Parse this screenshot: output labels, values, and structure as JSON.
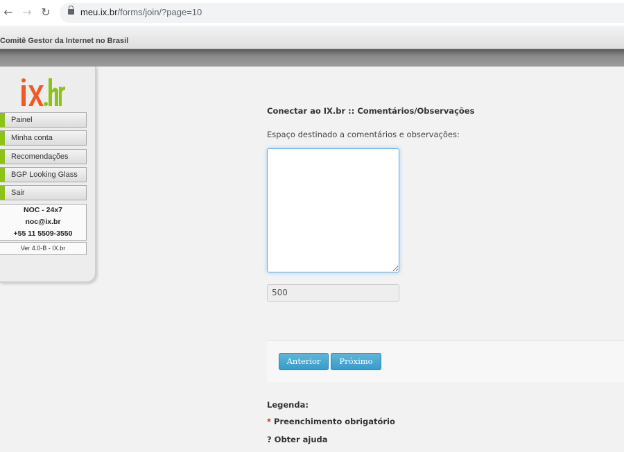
{
  "browser": {
    "url_domain": "meu.ix.br",
    "url_path": "/forms/join/?page=10",
    "back_icon": "arrow-left-icon",
    "forward_icon": "arrow-right-icon",
    "reload_icon": "reload-icon"
  },
  "site": {
    "header_title": "Comitê Gestor da Internet no Brasil",
    "logo_text": "ix.br",
    "accent_color": "#8cc21a",
    "logo_colors": {
      "ix": "#ef5a24",
      "br": "#8cc21a"
    }
  },
  "sidebar": {
    "items": [
      {
        "label": "Painel"
      },
      {
        "label": "Minha conta"
      },
      {
        "label": "Recomendações"
      },
      {
        "label": "BGP Looking Glass"
      },
      {
        "label": "Sair"
      }
    ],
    "noc": {
      "title": "NOC - 24x7",
      "email": "noc@ix.br",
      "phone": "+55 11 5509-3550"
    },
    "version": "Ver 4.0-B - IX.br"
  },
  "form": {
    "title": "Conectar ao IX.br :: Comentários/Observações",
    "description": "Espaço destinado a comentários e observações:",
    "comments_value": "",
    "char_counter": "500",
    "prev_label": "Anterior",
    "next_label": "Próximo"
  },
  "legend": {
    "title": "Legenda:",
    "required_mark": "*",
    "required_text": "Preenchimento obrigatório",
    "help_text": "? Obter ajuda"
  }
}
